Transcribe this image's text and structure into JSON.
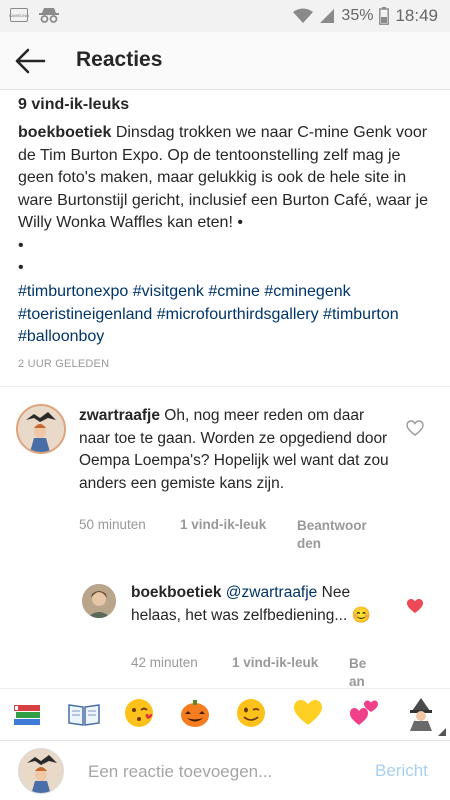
{
  "status_bar": {
    "battery_percent": "35%",
    "time": "18:49",
    "icons": [
      "samsung-icon",
      "incognito-icon",
      "wifi-icon",
      "signal-icon",
      "battery-icon"
    ]
  },
  "header": {
    "title": "Reacties",
    "back_icon": "back-arrow-icon"
  },
  "post": {
    "likes": "9 vind-ik-leuks",
    "username": "boekboetiek",
    "caption": "Dinsdag trokken we naar C-mine Genk voor de Tim Burton Expo. Op de tentoonstelling zelf mag je geen foto's maken, maar gelukkig is ook de hele site in ware Burtonstijl gericht, inclusief een Burton Café, waar je Willy Wonka Waffles kan eten! •",
    "bullet_2": "•",
    "bullet_3": "•",
    "hashtags": "#timburtonexpo #visitgenk #cmine #cminegenk #toeristineigenland #microfourthirdsgallery #timburton #balloonboy",
    "time_ago": "2 UUR GELEDEN"
  },
  "comments": [
    {
      "username": "zwartraafje",
      "text": "Oh, nog meer reden om daar naar toe te gaan. Worden ze opgediend door Oempa Loempa's? Hopelijk wel want dat zou anders een gemiste kans zijn.",
      "time": "50 minuten",
      "likes": "1 vind-ik-leuk",
      "reply_line1": "Beantwoor",
      "reply_line2": "den",
      "liked": false
    },
    {
      "username": "boekboetiek",
      "mention": "@zwartraafje",
      "text": "Nee helaas, het was zelfbediening... 😊",
      "time": "42 minuten",
      "likes": "1 vind-ik-leuk",
      "reply_line1": "Be",
      "reply_line2": "an",
      "liked": true,
      "heart_color": "#ed4956"
    }
  ],
  "emoji_bar": [
    "📚",
    "📖",
    "😘",
    "🎃",
    "😉",
    "💛",
    "💕",
    "🧙"
  ],
  "input": {
    "placeholder": "Een reactie toevoegen...",
    "value": "",
    "send_label": "Bericht",
    "send_color": "#a7d0f0"
  },
  "colors": {
    "hashtag": "#003569",
    "meta": "#999999",
    "text": "#262626"
  }
}
